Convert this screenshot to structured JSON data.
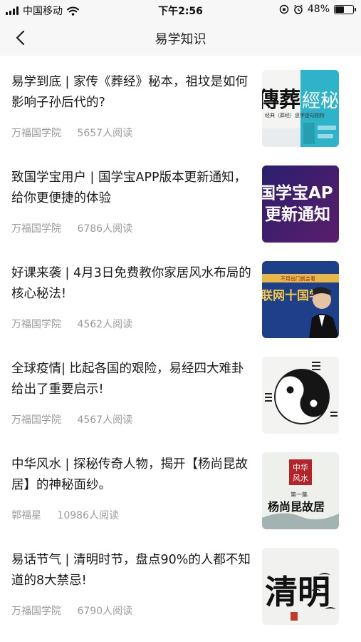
{
  "status_bar": {
    "carrier": "中国移动",
    "time": "下午2:56",
    "battery_percent": "48%",
    "battery_level": 0.48
  },
  "nav": {
    "title": "易学知识",
    "back_icon": "chevron-left-icon"
  },
  "articles": [
    {
      "title": "易学到底 | 家传《葬经》秘本，祖坟是如何影响子孙后代的?",
      "source": "万福国学院",
      "reads": "5657人阅读",
      "thumb": {
        "text1": "傳葬",
        "text2": "經秘",
        "text3": "经典（葬经）逐字逐句剖析"
      }
    },
    {
      "title": "致国学宝用户 | 国学宝APP版本更新通知，给你更便捷的体验",
      "source": "万福国学院",
      "reads": "6786人阅读",
      "thumb": {
        "text1": "国学宝AP",
        "text2": "更新通知"
      }
    },
    {
      "title": "好课来袭 | 4月3日免费教你家居风水布局的核心秘法!",
      "source": "万福国学院",
      "reads": "4562人阅读",
      "thumb": {
        "text1": "联网十国学",
        "text2": "不用出门就会看"
      }
    },
    {
      "title": "全球疫情| 比起各国的艰险，易经四大难卦给出了重要启示!",
      "source": "万福国学院",
      "reads": "4567人阅读",
      "thumb": {}
    },
    {
      "title": "中华风水 | 探秘传奇人物，揭开【杨尚昆故居】的神秘面纱。",
      "source": "郭福星",
      "reads": "10986人阅读",
      "thumb": {
        "badge1": "中华",
        "badge2": "风水",
        "text1": "第一集",
        "text2": "杨尚昆故居"
      }
    },
    {
      "title": "易话节气 | 清明时节，盘点90%的人都不知道的8大禁忌!",
      "source": "万福国学院",
      "reads": "6790人阅读",
      "thumb": {
        "text1": "清明"
      }
    }
  ]
}
